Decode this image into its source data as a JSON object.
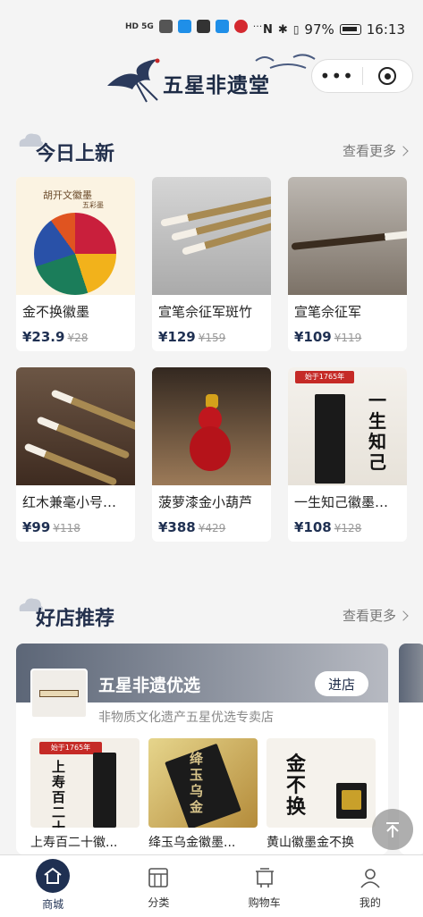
{
  "status_bar": {
    "signal": "HD 5G",
    "battery": "97%",
    "time": "16:13",
    "more": "···"
  },
  "header": {
    "title": "五星非遗堂",
    "capsule_more": "•••"
  },
  "section_new": {
    "title": "今日上新",
    "more": "查看更多"
  },
  "products": [
    {
      "name": "金不换徽墨",
      "price": "¥23.9",
      "old": "¥28",
      "thumb_caption": "胡开文徽墨",
      "thumb_caption2": "五彩墨"
    },
    {
      "name": "宣笔佘征军斑竹",
      "price": "¥129",
      "old": "¥159"
    },
    {
      "name": "宣笔佘征军",
      "price": "¥109",
      "old": "¥119"
    },
    {
      "name": "红木兼毫小号宣...",
      "price": "¥99",
      "old": "¥118"
    },
    {
      "name": "菠萝漆金小葫芦",
      "price": "¥388",
      "old": "¥429"
    },
    {
      "name": "一生知己徽墨胡...",
      "price": "¥108",
      "old": "¥128",
      "thumb_caption": "始于1765年",
      "thumb_big": "一生知己"
    }
  ],
  "section_shop": {
    "title": "好店推荐",
    "more": "查看更多"
  },
  "shop": {
    "name": "五星非遗优选",
    "enter": "进店",
    "desc": "非物质文化遗产五星优选专卖店",
    "items": [
      {
        "name": "上寿百二十徽...",
        "thumb_caption": "始于1765年",
        "thumb_big": "上寿百二十"
      },
      {
        "name": "绛玉乌金徽墨...",
        "thumb_big": "绛玉乌金"
      },
      {
        "name": "黄山徽墨金不换",
        "thumb_big": "金不换"
      }
    ]
  },
  "tabs": [
    {
      "label": "商城",
      "icon": "home-icon"
    },
    {
      "label": "分类",
      "icon": "category-icon"
    },
    {
      "label": "购物车",
      "icon": "cart-icon"
    },
    {
      "label": "我的",
      "icon": "user-icon"
    }
  ],
  "colors": {
    "accent": "#1f3052",
    "background": "#f4f4f4"
  }
}
